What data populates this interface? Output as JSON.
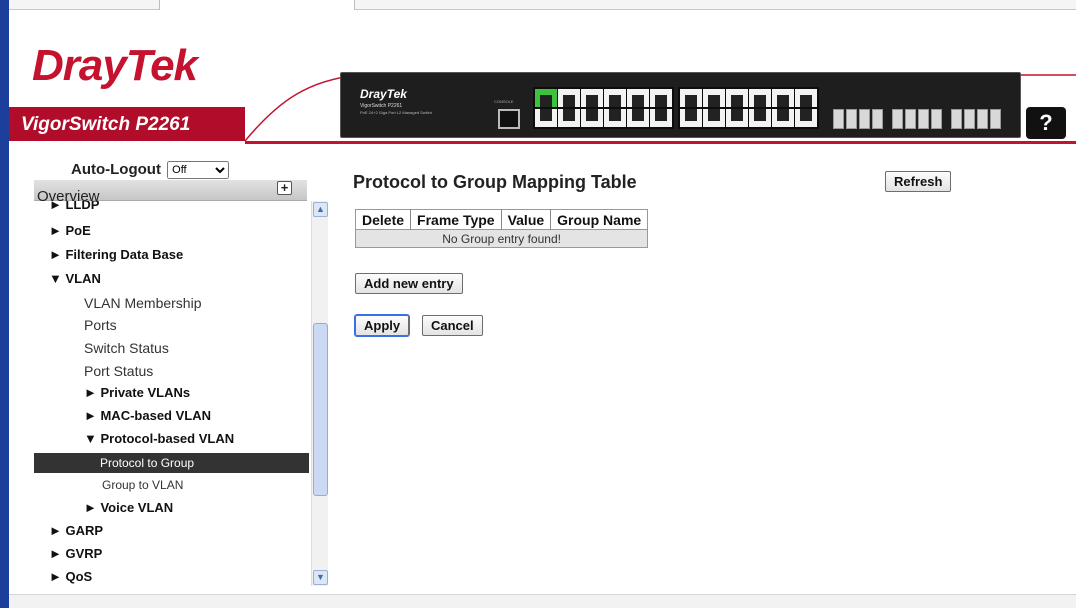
{
  "header": {
    "brand_part1": "Dray",
    "brand_part2": "Tek",
    "model": "VigorSwitch P2261",
    "device_brand": "DrayTek",
    "device_model": "VigorSwitch P2261",
    "device_subtitle": "PoE 24+2 Giga Port L2 Managed Switch",
    "device_console_label": "CONSOLE",
    "help_label": "?"
  },
  "sidebar": {
    "autologout_label": "Auto-Logout",
    "autologout_value": "Off",
    "section_title": "Overview",
    "items": [
      {
        "label": "► LLDP"
      },
      {
        "label": "► PoE"
      },
      {
        "label": "► Filtering Data Base"
      },
      {
        "label": "▼ VLAN"
      },
      {
        "label": "VLAN Membership"
      },
      {
        "label": "Ports"
      },
      {
        "label": "Switch Status"
      },
      {
        "label": "Port Status"
      },
      {
        "label": "► Private VLANs"
      },
      {
        "label": "► MAC-based VLAN"
      },
      {
        "label": "▼ Protocol-based VLAN"
      },
      {
        "label": "Protocol to Group"
      },
      {
        "label": "Group to VLAN"
      },
      {
        "label": "► Voice VLAN"
      },
      {
        "label": "► GARP"
      },
      {
        "label": "► GVRP"
      },
      {
        "label": "► QoS"
      }
    ]
  },
  "main": {
    "title": "Protocol to Group Mapping Table",
    "refresh_label": "Refresh",
    "table": {
      "columns": [
        "Delete",
        "Frame Type",
        "Value",
        "Group Name"
      ],
      "empty_message": "No Group entry found!"
    },
    "add_label": "Add new entry",
    "apply_label": "Apply",
    "cancel_label": "Cancel"
  },
  "colors": {
    "brand_red": "#c4122f",
    "selected_bg": "#333333",
    "window_frame": "#1c3f9b"
  }
}
